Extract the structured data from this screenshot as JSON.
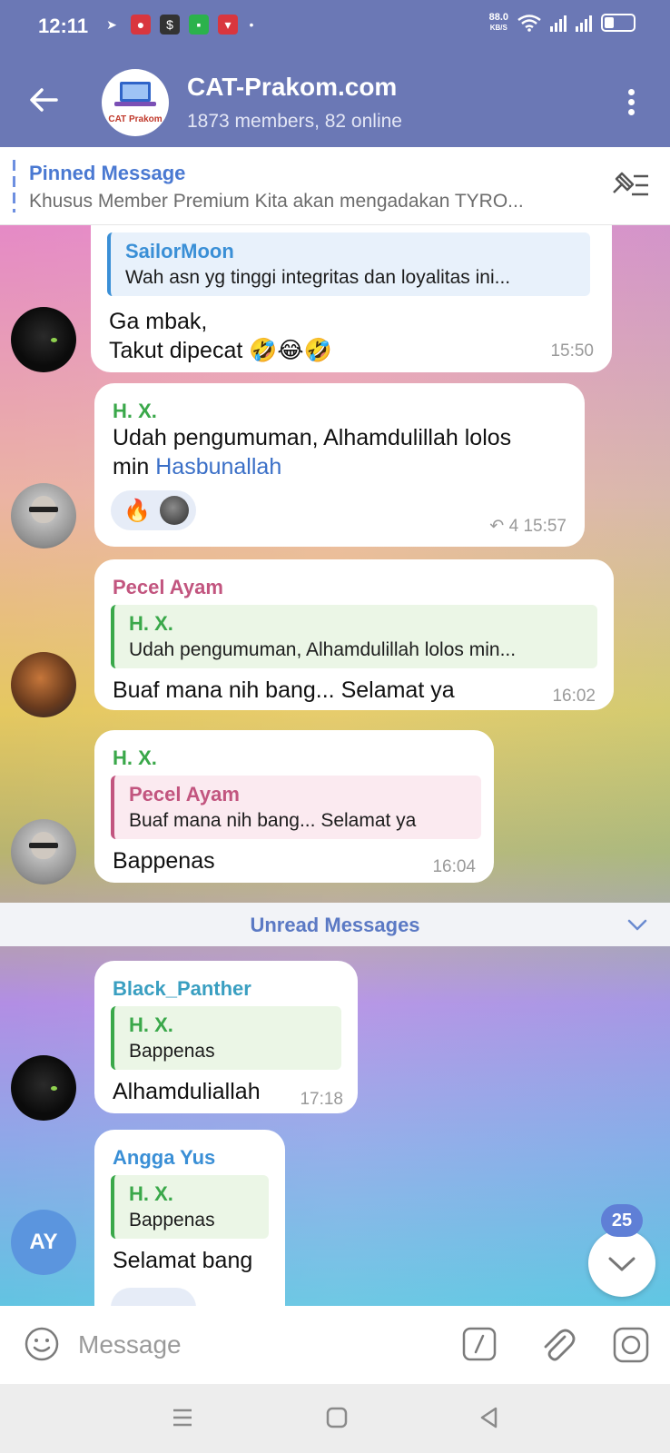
{
  "status_bar": {
    "time": "12:11",
    "net_speed": "88.0",
    "net_unit": "KB/S",
    "dot": "•"
  },
  "header": {
    "title": "CAT-Prakom.com",
    "subtitle": "1873 members, 82 online",
    "avatar_logo_text": "CAT Prakom"
  },
  "pinned": {
    "title": "Pinned Message",
    "text": "Khusus Member Premium Kita akan mengadakan TYRO..."
  },
  "messages": [
    {
      "reply_name": "SailorMoon",
      "reply_text": "Wah asn yg tinggi integritas dan loyalitas ini...",
      "text_line1": "Ga mbak,",
      "text_line2": "Takut dipecat 🤣😂🤣",
      "time": "15:50"
    },
    {
      "sender": "H. X.",
      "text_line1": "Udah pengumuman, Alhamdulillah lolos",
      "text_line2_plain": "min ",
      "text_line2_link": "Hasbunallah",
      "reaction_emoji": "🔥",
      "replies_count": "↶ 4",
      "time": "15:57"
    },
    {
      "sender": "Pecel Ayam",
      "reply_name": "H. X.",
      "reply_text": "Udah pengumuman, Alhamdulillah lolos min...",
      "text": "Buaf mana nih bang... Selamat ya",
      "time": "16:02"
    },
    {
      "sender": "H. X.",
      "reply_name": "Pecel Ayam",
      "reply_text": "Buaf mana nih bang... Selamat ya",
      "text": "Bappenas",
      "time": "16:04"
    },
    {
      "sender": "Black_Panther",
      "reply_name": "H. X.",
      "reply_text": "Bappenas",
      "text": "Alhamduliallah",
      "time": "17:18"
    },
    {
      "sender": "Angga Yus",
      "reply_name": "H. X.",
      "reply_text": "Bappenas",
      "text": "Selamat bang",
      "avatar_initials": "AY"
    }
  ],
  "unread_divider": "Unread Messages",
  "scroll_badge": "25",
  "input": {
    "placeholder": "Message"
  },
  "colors": {
    "header_bg": "#6b78b5",
    "sender_hx": "#3aa84a",
    "sender_pecel": "#c2557f",
    "sender_black_panther": "#3a9fc1",
    "sender_angga": "#3a8fd6",
    "reply_sailor": "#3a8fd6",
    "link": "#3a6fc7"
  }
}
